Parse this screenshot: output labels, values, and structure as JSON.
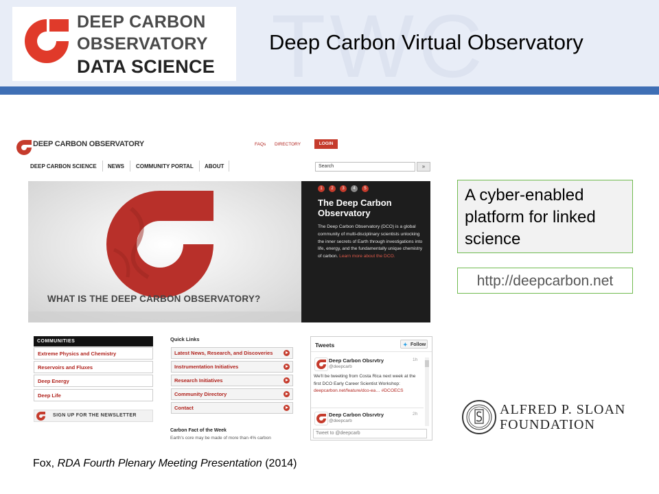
{
  "slide": {
    "title": "Deep Carbon Virtual Observatory",
    "watermark": "TWC",
    "logo": {
      "line1": "DEEP CARBON",
      "line2": "OBSERVATORY",
      "line3": "DATA SCIENCE"
    },
    "callout_main": "A cyber-enabled platform for linked science",
    "callout_url": "http://deepcarbon.net",
    "citation": {
      "author": "Fox, ",
      "title": "RDA Fourth Plenary  Meeting Presentation",
      "year": " (2014)"
    },
    "sponsor": {
      "line1": "ALFRED P. SLOAN",
      "line2": "FOUNDATION"
    },
    "colors": {
      "header_bg": "#e8edf7",
      "header_bar": "#3f6fb5",
      "dco_red": "#c53b2c",
      "callout_border": "#6fba4e"
    }
  },
  "site": {
    "brand": "DEEP CARBON OBSERVATORY",
    "top_links": {
      "faqs": "FAQs",
      "directory": "DIRECTORY",
      "login": "LOGIN"
    },
    "nav": [
      "DEEP CARBON SCIENCE",
      "NEWS",
      "COMMUNITY PORTAL",
      "ABOUT"
    ],
    "search": {
      "value": "Search",
      "button": "»"
    },
    "hero": {
      "dots": [
        "1",
        "2",
        "3",
        "4",
        "5"
      ],
      "active_dot": 4,
      "heading_line1": "The Deep Carbon",
      "heading_line2": "Observatory",
      "body": "The Deep Carbon Observatory (DCO) is a global community of multi-disciplinary scientists unlocking the inner secrets of Earth through investigations into life, energy, and the fundamentally unique chemistry of carbon.",
      "link": "Learn more about the DCO.",
      "caption": "WHAT IS THE DEEP CARBON OBSERVATORY?"
    },
    "communities": {
      "header": "COMMUNITIES",
      "items": [
        "Extreme Physics and Chemistry",
        "Reservoirs and Fluxes",
        "Deep Energy",
        "Deep Life"
      ]
    },
    "newsletter": "SIGN UP FOR THE NEWSLETTER",
    "quick_links": {
      "header": "Quick Links",
      "items": [
        "Latest News, Research, and Discoveries",
        "Instrumentation Initiatives",
        "Research Initiatives",
        "Community Directory",
        "Contact"
      ]
    },
    "fact": {
      "header": "Carbon Fact of the Week",
      "text": "Earth's core may be made of more than 4% carbon"
    },
    "tweets": {
      "header": "Tweets",
      "follow": "Follow",
      "items": [
        {
          "name": "Deep Carbon Obsrvtry",
          "handle": "@deepcarb",
          "time": "1h",
          "text": "We'll be tweeting from Costa Rica next week at the first DCO Early Career Scientist Workshop: ",
          "link": "deepcarbon.net/feature/dco-ea…",
          "tag": "#DCOECS"
        },
        {
          "name": "Deep Carbon Obsrvtry",
          "handle": "@deepcarb",
          "time": "2h"
        }
      ],
      "compose_placeholder": "Tweet to @deepcarb"
    }
  }
}
